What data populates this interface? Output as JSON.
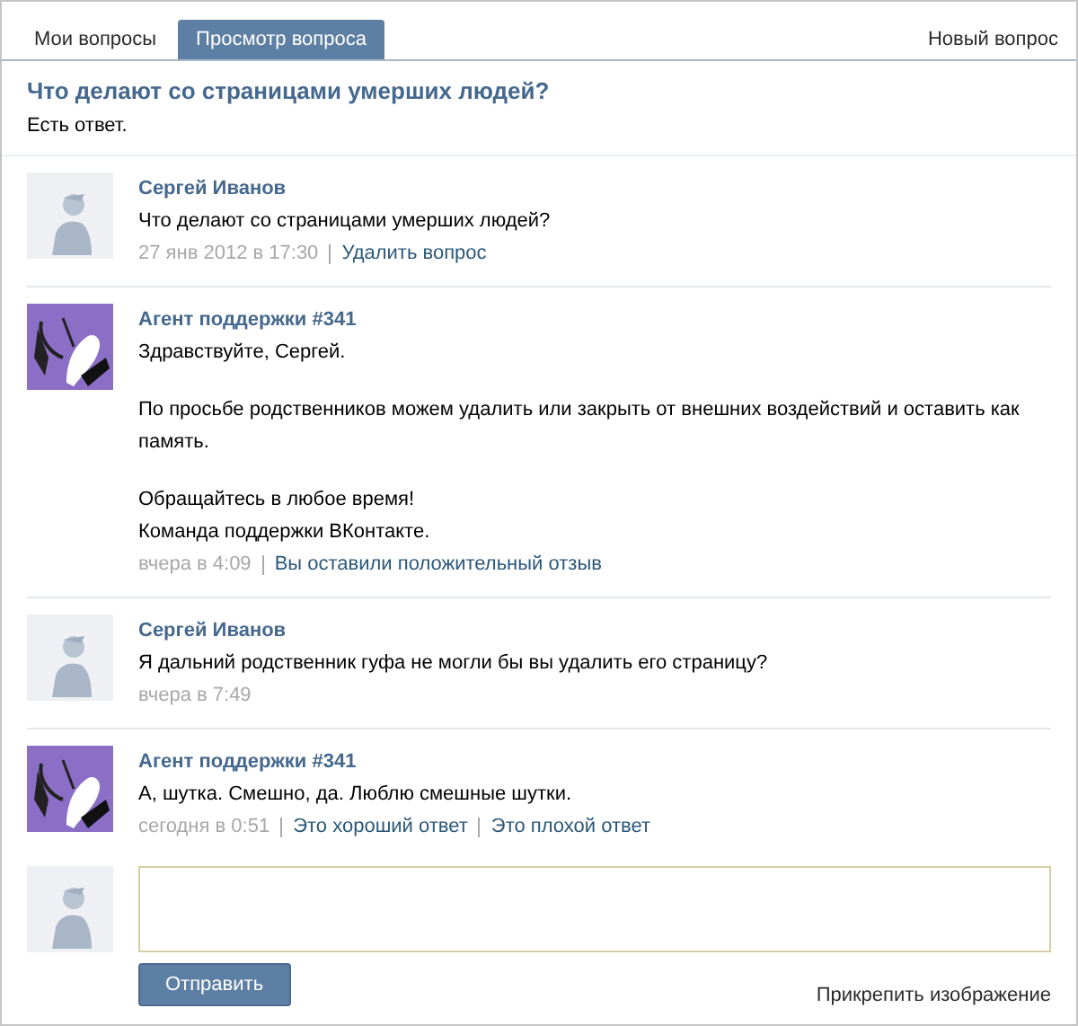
{
  "tabs": [
    {
      "label": "Мои вопросы",
      "selected": false
    },
    {
      "label": "Просмотр вопроса",
      "selected": true
    }
  ],
  "new_question_link": "Новый вопрос",
  "question": {
    "title": "Что делают со страницами умерших людей?",
    "status": "Есть ответ."
  },
  "messages": [
    {
      "author": "Сергей Иванов",
      "avatar": {
        "kind": "user"
      },
      "paragraphs": [
        [
          "Что делают со страницами умерших людей?"
        ]
      ],
      "time": "27 янв 2012 в 17:30",
      "links": [
        "Удалить вопрос"
      ]
    },
    {
      "author": "Агент поддержки #341",
      "avatar": {
        "kind": "agent"
      },
      "paragraphs": [
        [
          "Здравствуйте, Сергей."
        ],
        [
          "По просьбе родственников можем удалить или закрыть от внешних воздействий и оставить как память."
        ],
        [
          "Обращайтесь в любое время!",
          "Команда поддержки ВКонтакте."
        ]
      ],
      "time": "вчера в 4:09",
      "links": [
        "Вы оставили положительный отзыв"
      ]
    },
    {
      "author": "Сергей Иванов",
      "avatar": {
        "kind": "user"
      },
      "paragraphs": [
        [
          "Я дальний родственник гуфа не могли бы вы удалить его страницу?"
        ]
      ],
      "time": "вчера в 7:49"
    },
    {
      "author": "Агент поддержки #341",
      "avatar": {
        "kind": "agent"
      },
      "paragraphs": [
        [
          "А, шутка. Смешно, да. Люблю смешные шутки."
        ]
      ],
      "time": "сегодня в 0:51",
      "links": [
        "Это хороший ответ",
        "Это плохой ответ"
      ]
    }
  ],
  "reply": {
    "avatar": {
      "kind": "user"
    },
    "send_button": "Отправить",
    "attach_link": "Прикрепить изображение"
  }
}
